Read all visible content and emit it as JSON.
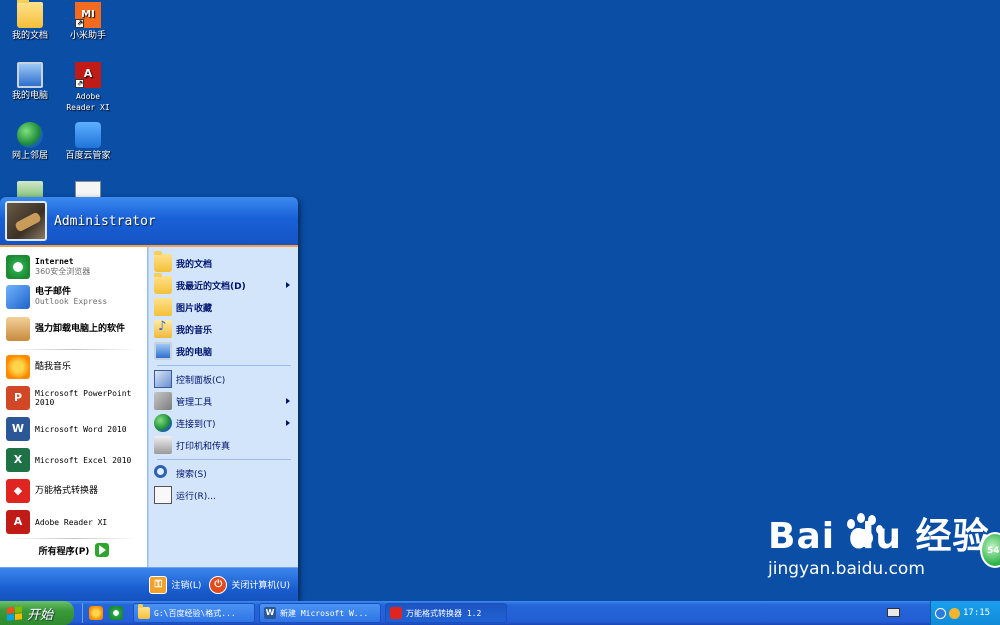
{
  "desktop": {
    "icons": [
      {
        "label": "我的文档",
        "icon": "my-documents-icon"
      },
      {
        "label": "小米助手",
        "icon": "mi-assistant-icon",
        "text": "MI"
      },
      {
        "label": "我的电脑",
        "icon": "my-computer-icon"
      },
      {
        "label": "Adobe\nReader XI",
        "icon": "adobe-reader-icon"
      },
      {
        "label": "网上邻居",
        "icon": "network-places-icon"
      },
      {
        "label": "百度云管家",
        "icon": "baidu-cloud-icon"
      }
    ]
  },
  "start_menu": {
    "user": "Administrator",
    "left_items": [
      {
        "title": "Internet",
        "subtitle": "360安全浏览器",
        "icon": "ie-icon"
      },
      {
        "title": "电子邮件",
        "subtitle": "Outlook Express",
        "icon": "email-icon"
      },
      {
        "title": "强力卸载电脑上的软件",
        "icon": "uninstall-icon"
      },
      {
        "title": "酷我音乐",
        "icon": "kuwo-music-icon"
      },
      {
        "title": "Microsoft PowerPoint 2010",
        "icon": "powerpoint-icon"
      },
      {
        "title": "Microsoft Word 2010",
        "icon": "word-icon"
      },
      {
        "title": "Microsoft Excel 2010",
        "icon": "excel-icon"
      },
      {
        "title": "万能格式转换器",
        "icon": "format-converter-icon"
      },
      {
        "title": "Adobe Reader XI",
        "icon": "adobe-reader-icon"
      }
    ],
    "all_programs": "所有程序(P)",
    "right_items": [
      {
        "label": "我的文档",
        "icon": "folder-icon"
      },
      {
        "label": "我最近的文档(D)",
        "icon": "folder-icon",
        "submenu": true
      },
      {
        "label": "图片收藏",
        "icon": "pictures-icon"
      },
      {
        "label": "我的音乐",
        "icon": "music-icon"
      },
      {
        "label": "我的电脑",
        "icon": "computer-icon"
      },
      {
        "label": "控制面板(C)",
        "icon": "control-panel-icon"
      },
      {
        "label": "管理工具",
        "icon": "admin-tools-icon",
        "submenu": true
      },
      {
        "label": "连接到(T)",
        "icon": "connect-icon",
        "submenu": true
      },
      {
        "label": "打印机和传真",
        "icon": "printer-icon"
      },
      {
        "label": "搜索(S)",
        "icon": "search-icon"
      },
      {
        "label": "运行(R)...",
        "icon": "run-icon"
      }
    ],
    "logoff": "注销(L)",
    "shutdown": "关闭计算机(U)"
  },
  "taskbar": {
    "start_label": "开始",
    "tasks": [
      {
        "label": "G:\\百度经验\\格式...",
        "icon": "folder-icon"
      },
      {
        "label": "新建 Microsoft W...",
        "icon": "word-icon"
      },
      {
        "label": "万能格式转换器 1.2",
        "icon": "format-converter-icon"
      }
    ],
    "clock": "17:15"
  },
  "watermark": {
    "logo": "Bai du 经验",
    "url": "jingyan.baidu.com"
  },
  "side_badge": "54"
}
